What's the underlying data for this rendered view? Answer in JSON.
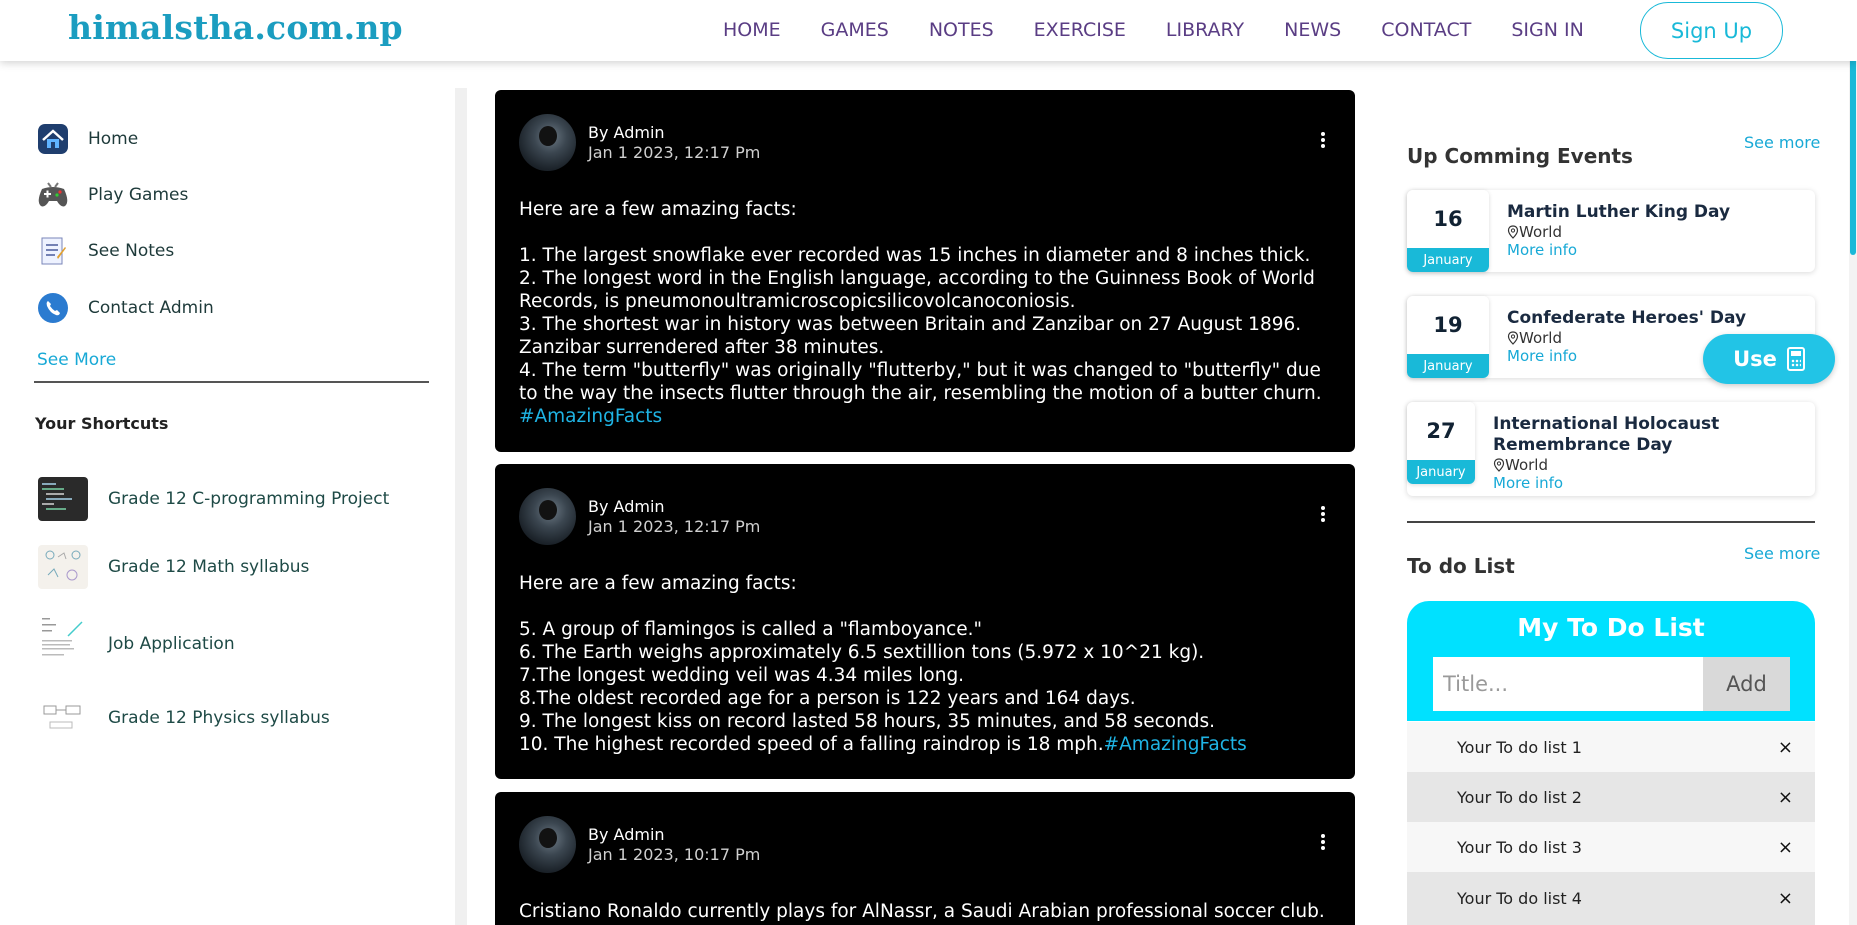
{
  "header": {
    "logo": "himalstha.com.np",
    "nav": [
      "HOME",
      "GAMES",
      "NOTES",
      "EXERCISE",
      "LIBRARY",
      "NEWS",
      "CONTACT",
      "SIGN IN"
    ],
    "signup": "Sign Up"
  },
  "sidebar": {
    "items": [
      {
        "label": "Home",
        "icon": "home-icon"
      },
      {
        "label": "Play Games",
        "icon": "gamepad-icon"
      },
      {
        "label": "See Notes",
        "icon": "notes-icon"
      },
      {
        "label": "Contact Admin",
        "icon": "phone-icon"
      }
    ],
    "see_more": "See More",
    "shortcuts_title": "Your Shortcuts",
    "shortcuts": [
      {
        "label": "Grade 12 C-programming Project"
      },
      {
        "label": "Grade 12 Math syllabus"
      },
      {
        "label": "Job Application"
      },
      {
        "label": "Grade 12 Physics syllabus"
      }
    ]
  },
  "posts": [
    {
      "author": "By Admin",
      "date": "Jan 1 2023, 12:17 Pm",
      "lines": [
        "Here are a few amazing facts:",
        "",
        "1. The largest snowflake ever recorded was 15 inches in diameter and 8 inches thick.",
        "2. The longest word in the English language, according to the Guinness Book of World",
        "Records, is pneumonoultramicroscopicsilicovolcanoconiosis.",
        "3. The shortest war in history was between Britain and Zanzibar on 27 August 1896.",
        "Zanzibar surrendered after 38 minutes.",
        "4. The term \"butterfly\" was originally \"flutterby,\" but it was changed to \"butterfly\" due",
        "to the way the insects flutter through the air, resembling the motion of a butter churn."
      ],
      "tag": "#AmazingFacts"
    },
    {
      "author": "By Admin",
      "date": "Jan 1 2023, 12:17 Pm",
      "lines": [
        "Here are a few amazing facts:",
        "",
        "5. A group of flamingos is called a \"flamboyance.\"",
        "6. The Earth weighs approximately 6.5 sextillion tons (5.972 x 10^21 kg).",
        "7.The longest wedding veil was 4.34 miles long.",
        "8.The oldest recorded age for a person is 122 years and 164 days.",
        "9. The longest kiss on record lasted 58 hours, 35 minutes, and 58 seconds.",
        "10. The highest recorded speed of a falling raindrop is 18 mph."
      ],
      "tag": "#AmazingFacts"
    },
    {
      "author": "By Admin",
      "date": "Jan 1 2023, 10:17 Pm",
      "lines": [
        "Cristiano Ronaldo currently plays for AlNassr, a Saudi Arabian professional soccer club."
      ]
    }
  ],
  "events": {
    "title": "Up Comming Events",
    "see_more": "See more",
    "items": [
      {
        "day": "16",
        "month": "January",
        "name": "Martin Luther King Day",
        "place": "World",
        "more": "More info"
      },
      {
        "day": "19",
        "month": "January",
        "name": "Confederate Heroes' Day",
        "place": "World",
        "more": "More info"
      },
      {
        "day": "27",
        "month": "January",
        "name": "International Holocaust Remembrance Day",
        "place": "World",
        "more": "More info"
      }
    ]
  },
  "todo": {
    "title": "To do List",
    "see_more": "See more",
    "heading": "My To Do List",
    "placeholder": "Title...",
    "add": "Add",
    "items": [
      "Your To do list 1",
      "Your To do list 2",
      "Your To do list 3",
      "Your To do list 4"
    ],
    "close": "×"
  },
  "use_button": "Use",
  "colors": {
    "accent": "#19b9d8",
    "nav": "#5a3d84",
    "todo_card": "#00e1ff",
    "post_bg": "#000000",
    "tag": "#1fb4e4"
  }
}
